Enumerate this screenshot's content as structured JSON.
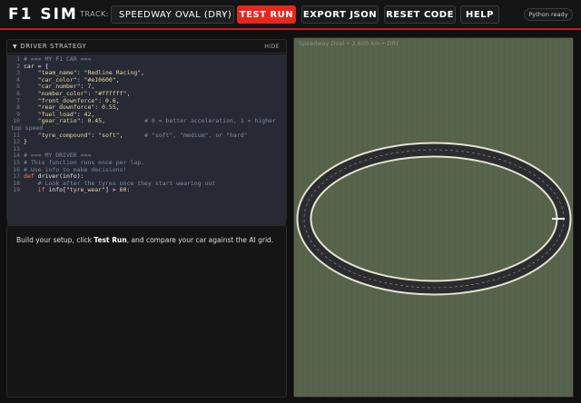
{
  "header": {
    "logo": "F1 SIM",
    "track_label": "TRACK:",
    "track_selected": "SPEEDWAY OVAL (DRY)",
    "buttons": {
      "test_run": "TEST RUN",
      "export": "EXPORT JSON",
      "reset": "RESET CODE",
      "help": "HELP"
    },
    "status": "Python ready"
  },
  "strategy": {
    "title": "DRIVER STRATEGY",
    "hide": "HIDE",
    "code_lines": [
      [
        {
          "t": "# === MY F1 CAR ===",
          "c": "c-com"
        }
      ],
      [
        {
          "t": "car",
          "c": "c-id"
        },
        {
          "t": " = {",
          "c": "c-id"
        }
      ],
      [
        {
          "t": "    ",
          "c": "c-id"
        },
        {
          "t": "\"team_name\"",
          "c": "c-str"
        },
        {
          "t": ": ",
          "c": "c-id"
        },
        {
          "t": "\"Redline Racing\"",
          "c": "c-str"
        },
        {
          "t": ",",
          "c": "c-id"
        }
      ],
      [
        {
          "t": "    ",
          "c": "c-id"
        },
        {
          "t": "\"car_color\"",
          "c": "c-str"
        },
        {
          "t": ": ",
          "c": "c-id"
        },
        {
          "t": "\"#e10600\"",
          "c": "c-str"
        },
        {
          "t": ",",
          "c": "c-id"
        }
      ],
      [
        {
          "t": "    ",
          "c": "c-id"
        },
        {
          "t": "\"car_number\"",
          "c": "c-str"
        },
        {
          "t": ": ",
          "c": "c-id"
        },
        {
          "t": "7",
          "c": "c-num"
        },
        {
          "t": ",",
          "c": "c-id"
        }
      ],
      [
        {
          "t": "    ",
          "c": "c-id"
        },
        {
          "t": "\"number_color\"",
          "c": "c-str"
        },
        {
          "t": ": ",
          "c": "c-id"
        },
        {
          "t": "\"#ffffff\"",
          "c": "c-str"
        },
        {
          "t": ",",
          "c": "c-id"
        }
      ],
      [
        {
          "t": "    ",
          "c": "c-id"
        },
        {
          "t": "\"front_downforce\"",
          "c": "c-str"
        },
        {
          "t": ": ",
          "c": "c-id"
        },
        {
          "t": "0.6",
          "c": "c-num"
        },
        {
          "t": ",",
          "c": "c-id"
        }
      ],
      [
        {
          "t": "    ",
          "c": "c-id"
        },
        {
          "t": "\"rear_downforce\"",
          "c": "c-str"
        },
        {
          "t": ": ",
          "c": "c-id"
        },
        {
          "t": "0.55",
          "c": "c-num"
        },
        {
          "t": ",",
          "c": "c-id"
        }
      ],
      [
        {
          "t": "    ",
          "c": "c-id"
        },
        {
          "t": "\"fuel_load\"",
          "c": "c-str"
        },
        {
          "t": ": ",
          "c": "c-id"
        },
        {
          "t": "42",
          "c": "c-num"
        },
        {
          "t": ",",
          "c": "c-id"
        }
      ],
      [
        {
          "t": "    ",
          "c": "c-id"
        },
        {
          "t": "\"gear_ratio\"",
          "c": "c-str"
        },
        {
          "t": ": ",
          "c": "c-id"
        },
        {
          "t": "0.45",
          "c": "c-num"
        },
        {
          "t": ",           ",
          "c": "c-id"
        },
        {
          "t": "# 0 = better acceleration, 1 = higher",
          "c": "c-com"
        }
      ],
      [
        {
          "t": "top speed",
          "c": "c-com",
          "wrap": true
        }
      ],
      [
        {
          "t": "    ",
          "c": "c-id"
        },
        {
          "t": "\"tyre_compound\"",
          "c": "c-str"
        },
        {
          "t": ": ",
          "c": "c-id"
        },
        {
          "t": "\"soft\"",
          "c": "c-str"
        },
        {
          "t": ",      ",
          "c": "c-id"
        },
        {
          "t": "# \"soft\", \"medium\", or \"hard\"",
          "c": "c-com"
        }
      ],
      [
        {
          "t": "}",
          "c": "c-id"
        }
      ],
      [
        {
          "t": "",
          "c": "c-id"
        }
      ],
      [
        {
          "t": "# === MY DRIVER ===",
          "c": "c-com"
        }
      ],
      [
        {
          "t": "# This function runs once per lap.",
          "c": "c-com"
        }
      ],
      [
        {
          "t": "# Use info to make decisions!",
          "c": "c-com"
        }
      ],
      [
        {
          "t": "def",
          "c": "c-kw"
        },
        {
          "t": " driver(info):",
          "c": "c-id"
        }
      ],
      [
        {
          "t": "    ",
          "c": "c-id"
        },
        {
          "t": "# Look after the tyres once they start wearing out",
          "c": "c-com"
        }
      ],
      [
        {
          "t": "    ",
          "c": "c-id"
        },
        {
          "t": "if",
          "c": "c-kw"
        },
        {
          "t": " info[",
          "c": "c-id"
        },
        {
          "t": "\"tyre_wear\"",
          "c": "c-str"
        },
        {
          "t": "] > ",
          "c": "c-id"
        },
        {
          "t": "60",
          "c": "c-num"
        },
        {
          "t": ":",
          "c": "c-id"
        }
      ]
    ],
    "line_numbers": [
      "1",
      "2",
      "3",
      "4",
      "5",
      "6",
      "7",
      "8",
      "9",
      "10",
      "",
      "11",
      "12",
      "13",
      "14",
      "15",
      "16",
      "17",
      "18",
      "19"
    ]
  },
  "console": {
    "pre": "Build your setup, click ",
    "bold": "Test Run",
    "post": ", and compare your car against the AI grid."
  },
  "viewport": {
    "label": "Speedway Oval • 2.600 km • DRY",
    "background_color": "#56624a",
    "track_color": "#2a2c30",
    "edge_color": "#e6e2d2"
  },
  "colors": {
    "accent": "#e8261b",
    "panel": "#151515",
    "editor": "#272a34"
  }
}
